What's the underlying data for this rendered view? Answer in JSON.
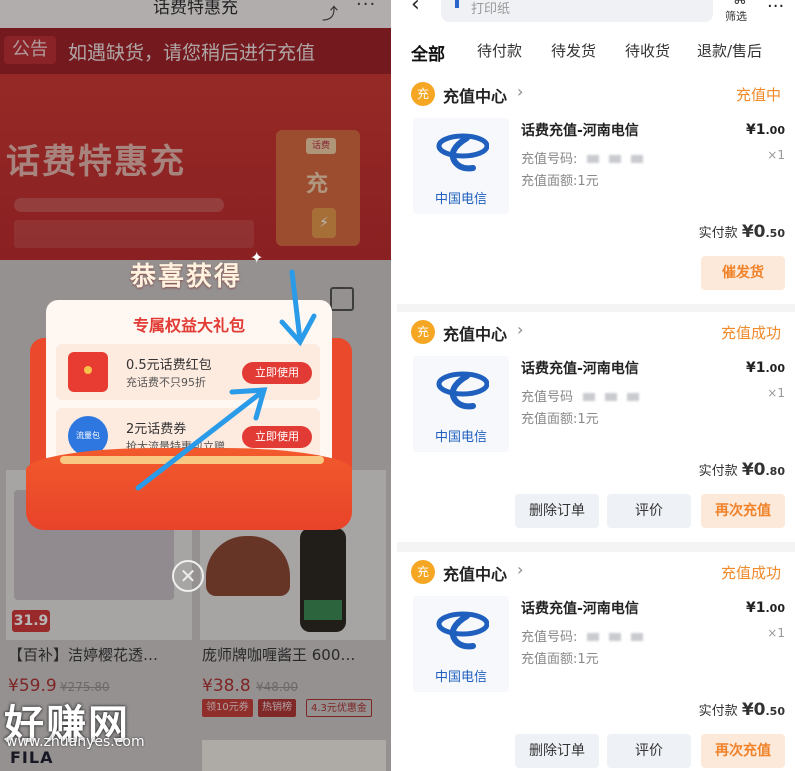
{
  "left": {
    "title": "话费特惠充",
    "notice_tag": "公告",
    "notice_text": "如遇缺货，请您稍后进行充值",
    "banner_title": "话费特惠充",
    "banner_card_tag": "话费",
    "banner_card_char": "充",
    "popup": {
      "congrats": "恭喜获得",
      "title": "专属权益大礼包",
      "coupons": [
        {
          "title": "0.5元话费红包",
          "desc": "充话费不只95折",
          "button": "立即使用",
          "icon": "red-envelope-icon"
        },
        {
          "title": "2元话费券",
          "desc": "抢大流量特惠包立赠",
          "button": "立即使用",
          "icon": "data-pack-icon",
          "icon_text": "流量包"
        }
      ],
      "close": "✕"
    },
    "products": [
      {
        "name": "【百补】洁婷樱花透…",
        "price": "¥59.9",
        "old": "¥275.80",
        "price_tag": "31.9"
      },
      {
        "name": "庞师牌咖喱酱王 600…",
        "price": "¥38.8",
        "old": "¥48.00",
        "tags": [
          "领10元券",
          "热销榜",
          "4.3元优惠金"
        ]
      }
    ],
    "brand": "FILA",
    "watermark": "好赚网",
    "watermark_url": "www.zhuanyes.com"
  },
  "right": {
    "search_placeholder": "打印纸",
    "filter_label": "筛选",
    "tabs": [
      "全部",
      "待付款",
      "待发货",
      "待收货",
      "退款/售后"
    ],
    "orders": [
      {
        "shop": "充值中心",
        "status": "充值中",
        "logo_text": "中国电信",
        "title": "话费充值-河南电信",
        "phone_label": "充值号码:",
        "face_value": "充值面额:1元",
        "price_int": "¥1",
        "price_dec": ".00",
        "qty": "×1",
        "paid_label": "实付款",
        "paid_int": "¥0",
        "paid_dec": ".50",
        "buttons": [
          "催发货"
        ]
      },
      {
        "shop": "充值中心",
        "status": "充值成功",
        "logo_text": "中国电信",
        "title": "话费充值-河南电信",
        "phone_label": "充值号码",
        "face_value": "充值面额:1元",
        "price_int": "¥1",
        "price_dec": ".00",
        "qty": "×1",
        "paid_label": "实付款",
        "paid_int": "¥0",
        "paid_dec": ".80",
        "buttons": [
          "删除订单",
          "评价",
          "再次充值"
        ]
      },
      {
        "shop": "充值中心",
        "status": "充值成功",
        "logo_text": "中国电信",
        "title": "话费充值-河南电信",
        "phone_label": "充值号码:",
        "face_value": "充值面额:1元",
        "price_int": "¥1",
        "price_dec": ".00",
        "qty": "×1",
        "paid_label": "实付款",
        "paid_int": "¥0",
        "paid_dec": ".50",
        "buttons": [
          "删除订单",
          "评价",
          "再次充值"
        ]
      }
    ]
  },
  "colors": {
    "accent_red": "#e23b35",
    "status_orange": "#f08a2a",
    "telecom_blue": "#1f5fbe"
  }
}
